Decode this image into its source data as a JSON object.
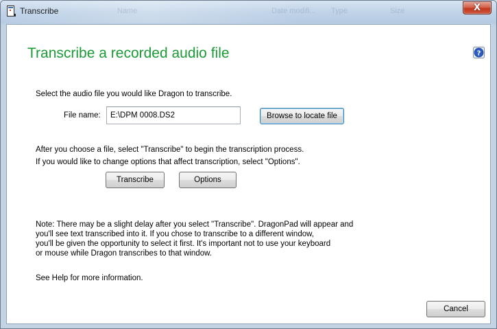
{
  "window": {
    "title": "Transcribe",
    "close_label": "X",
    "background_ghost_labels": [
      "Name",
      "Date modifi...",
      "Type",
      "Size"
    ]
  },
  "heading": "Transcribe a recorded audio file",
  "help_icon": "help-icon",
  "select_prompt": "Select the audio file you would like Dragon to transcribe.",
  "file": {
    "label": "File name:",
    "value": "E:\\DPM 0008.DS2"
  },
  "browse_label": "Browse to locate file",
  "instructions": [
    "After you choose a file, select \"Transcribe\" to begin the transcription process.",
    "If you would like to change options that affect transcription, select \"Options\"."
  ],
  "transcribe_label": "Transcribe",
  "options_label": "Options",
  "note_lines": [
    "Note: There may be a slight delay after you select \"Transcribe\". DragonPad will appear and",
    "you'll see text transcribed into it. If you chose to transcribe to a different window,",
    "you'll be given the opportunity to select it first. It's important not to use your keyboard",
    "or mouse while Dragon transcribes to that window."
  ],
  "help_text": "See Help for more information.",
  "cancel_label": "Cancel",
  "colors": {
    "heading": "#1c9a36",
    "close_button": "#c7432b",
    "help_icon": "#2a5cc4"
  }
}
